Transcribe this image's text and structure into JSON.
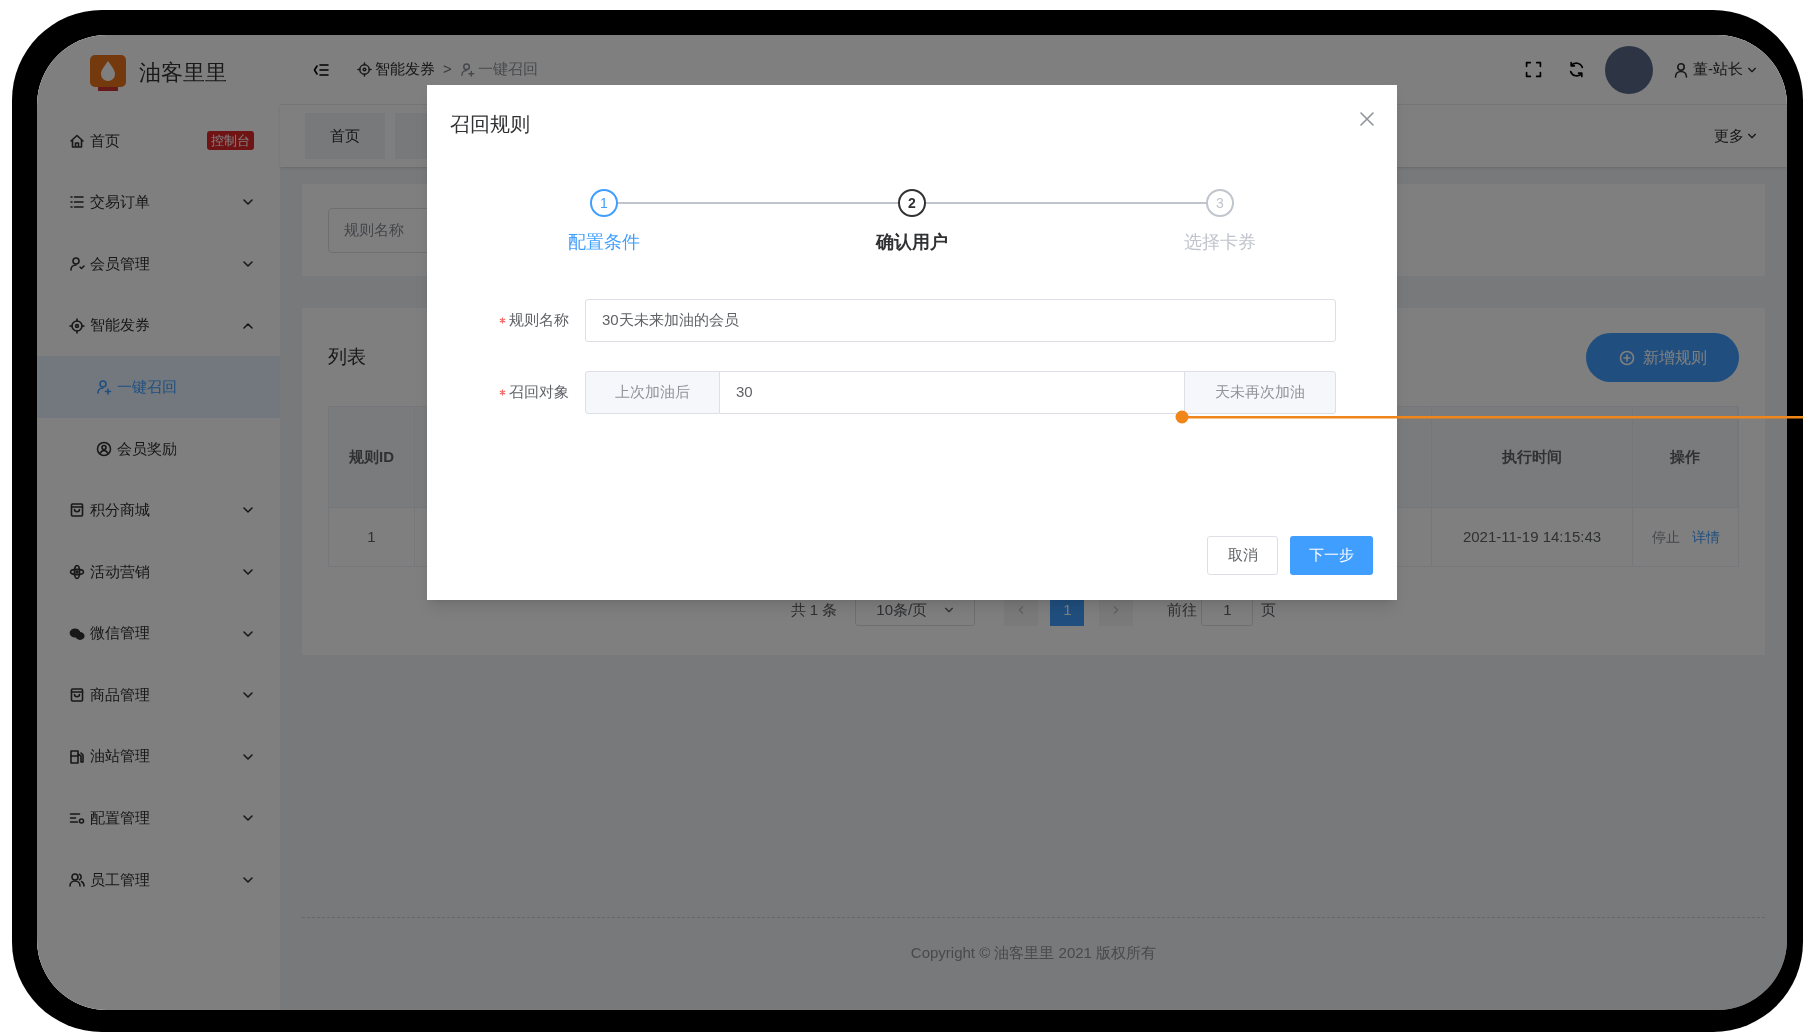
{
  "app": {
    "name": "油客里里"
  },
  "sidebar": {
    "items": [
      {
        "label": "首页",
        "badge": "控制台",
        "selected": false
      },
      {
        "label": "交易订单",
        "expanded": false,
        "selected": false
      },
      {
        "label": "会员管理",
        "expanded": false,
        "selected": false
      },
      {
        "label": "智能发券",
        "expanded": true,
        "selected": false,
        "children": [
          {
            "label": "一键召回",
            "selected": true
          },
          {
            "label": "会员奖励",
            "selected": false
          }
        ]
      },
      {
        "label": "积分商城",
        "expanded": false,
        "selected": false
      },
      {
        "label": "活动营销",
        "expanded": false,
        "selected": false
      },
      {
        "label": "微信管理",
        "expanded": false,
        "selected": false
      },
      {
        "label": "商品管理",
        "expanded": false,
        "selected": false
      },
      {
        "label": "油站管理",
        "expanded": false,
        "selected": false
      },
      {
        "label": "配置管理",
        "expanded": false,
        "selected": false
      },
      {
        "label": "员工管理",
        "expanded": false,
        "selected": false
      }
    ]
  },
  "header": {
    "breadcrumb": [
      {
        "label": "智能发券"
      },
      {
        "label": "一键召回"
      }
    ],
    "breadcrumb_separator": ">",
    "user": {
      "name": "董-站长"
    }
  },
  "tabs": [
    {
      "label": "首页",
      "selected": false
    }
  ],
  "more_menu": "更多",
  "search": {
    "placeholder": "规则名称"
  },
  "list": {
    "title": "列表",
    "add_button": "新增规则",
    "table": {
      "columns": [
        {
          "label": "规则ID"
        },
        {
          "label": "执行时间"
        },
        {
          "label": "操作"
        }
      ],
      "rows": [
        {
          "cells": [
            "1",
            "2021-11-19 14:15:43"
          ],
          "actions": [
            {
              "label": "停止",
              "kind": "muted"
            },
            {
              "label": "详情",
              "kind": "link"
            }
          ]
        }
      ]
    },
    "pagination": {
      "total": "共 1 条",
      "page_size": "10条/页",
      "pages": [
        {
          "label": "1",
          "selected": true
        }
      ],
      "goto_label": "前往",
      "goto_value": "1",
      "goto_suffix": "页"
    }
  },
  "footer": "Copyright © 油客里里 2021 版权所有",
  "dialog": {
    "title": "召回规则",
    "steps": [
      {
        "number": "1",
        "label": "配置条件",
        "selected": false
      },
      {
        "number": "2",
        "label": "确认用户",
        "selected": true
      },
      {
        "number": "3",
        "label": "选择卡券",
        "selected": false
      }
    ],
    "fields": [
      {
        "label": "规则名称",
        "required": true,
        "kind": "text",
        "value": "30天未来加油的会员"
      },
      {
        "label": "召回对象",
        "required": true,
        "kind": "group",
        "prepend": "上次加油后",
        "value": "30",
        "append": "天未再次加油"
      }
    ],
    "buttons": [
      {
        "label": "取消",
        "kind": "default"
      },
      {
        "label": "下一步",
        "kind": "primary"
      }
    ]
  }
}
